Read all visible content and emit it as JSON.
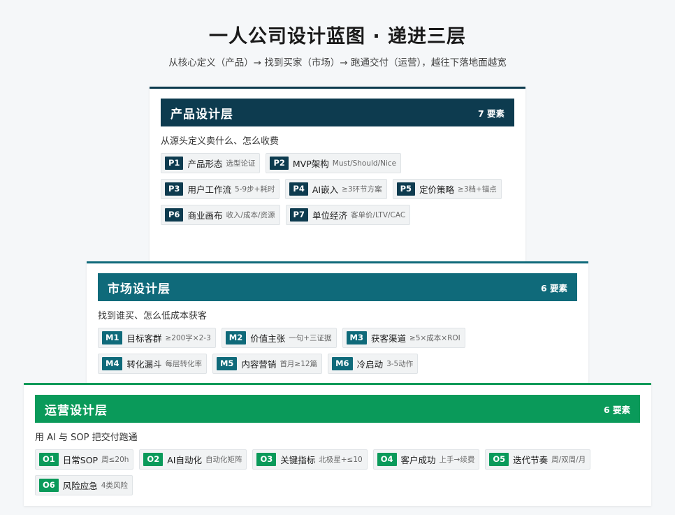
{
  "title": "一人公司设计蓝图 · 递进三层",
  "subtitle": "从核心定义（产品）→ 找到买家（市场）→ 跑通交付（运营），越往下落地面越宽",
  "layers": [
    {
      "name": "产品设计层",
      "count": "7 要素",
      "color": "#0d3b4f",
      "desc": "从源头定义卖什么、怎么收费",
      "items": [
        {
          "code": "P1",
          "name": "产品形态",
          "note": "选型论证"
        },
        {
          "code": "P2",
          "name": "MVP架构",
          "note": "Must/Should/Nice"
        },
        {
          "code": "P3",
          "name": "用户工作流",
          "note": "5-9步+耗时"
        },
        {
          "code": "P4",
          "name": "AI嵌入",
          "note": "≥3环节方案"
        },
        {
          "code": "P5",
          "name": "定价策略",
          "note": "≥3档+锚点"
        },
        {
          "code": "P6",
          "name": "商业画布",
          "note": "收入/成本/资源"
        },
        {
          "code": "P7",
          "name": "单位经济",
          "note": "客单价/LTV/CAC"
        }
      ]
    },
    {
      "name": "市场设计层",
      "count": "6 要素",
      "color": "#0f6a7a",
      "desc": "找到谁买、怎么低成本获客",
      "items": [
        {
          "code": "M1",
          "name": "目标客群",
          "note": "≥200字×2-3"
        },
        {
          "code": "M2",
          "name": "价值主张",
          "note": "一句+三证据"
        },
        {
          "code": "M3",
          "name": "获客渠道",
          "note": "≥5×成本×ROI"
        },
        {
          "code": "M4",
          "name": "转化漏斗",
          "note": "每层转化率"
        },
        {
          "code": "M5",
          "name": "内容营销",
          "note": "首月≥12篇"
        },
        {
          "code": "M6",
          "name": "冷启动",
          "note": "3-5动作"
        }
      ]
    },
    {
      "name": "运营设计层",
      "count": "6 要素",
      "color": "#0a9a5a",
      "desc": "用 AI 与 SOP 把交付跑通",
      "items": [
        {
          "code": "O1",
          "name": "日常SOP",
          "note": "周≤20h"
        },
        {
          "code": "O2",
          "name": "AI自动化",
          "note": "自动化矩阵"
        },
        {
          "code": "O3",
          "name": "关键指标",
          "note": "北极星+≤10"
        },
        {
          "code": "O4",
          "name": "客户成功",
          "note": "上手→续费"
        },
        {
          "code": "O5",
          "name": "迭代节奏",
          "note": "周/双周/月"
        },
        {
          "code": "O6",
          "name": "风险应急",
          "note": "4类风险"
        }
      ]
    }
  ]
}
